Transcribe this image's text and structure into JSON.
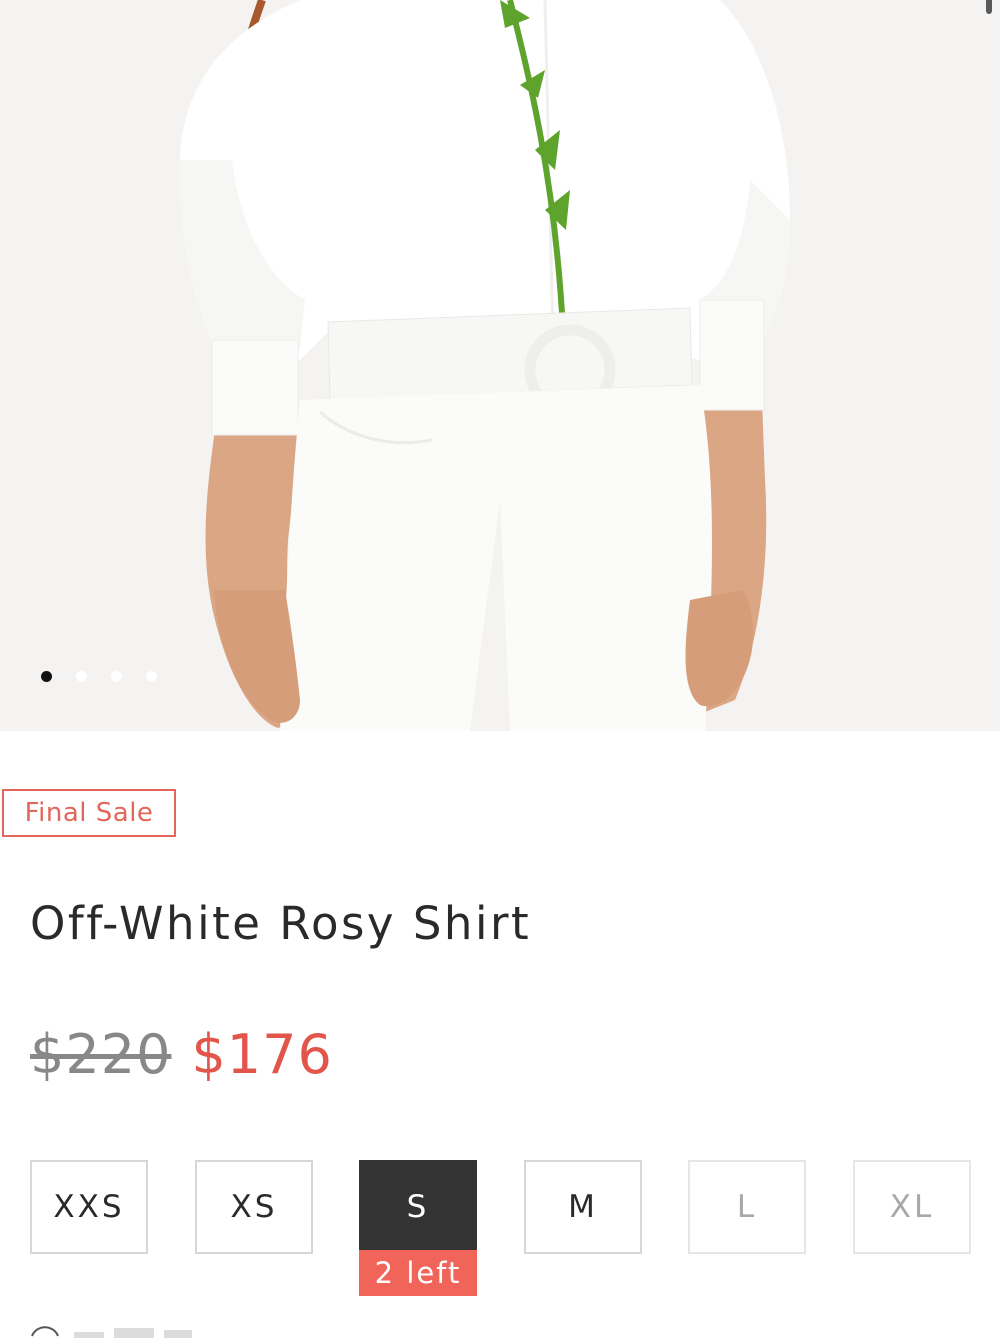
{
  "gallery": {
    "slide_count": 4,
    "active_index": 0,
    "colors": {
      "background": "#f4f3f1",
      "garment": "#ffffff",
      "skin": "#d9a27f",
      "stem": "#5ea32c"
    }
  },
  "product": {
    "badge": "Final Sale",
    "title": "Off-White Rosy Shirt",
    "price_original": "$220",
    "price_sale": "$176"
  },
  "sizes": {
    "options": [
      "XXS",
      "XS",
      "S",
      "M",
      "L",
      "XL"
    ],
    "selected": "S",
    "unavailable": [
      "L",
      "XL"
    ],
    "stock_note": "2 left"
  },
  "colors": {
    "accent": "#e2554a",
    "badge_border": "#e2675a",
    "selected_size_bg": "#333333",
    "stock_bg": "#f0645a"
  }
}
